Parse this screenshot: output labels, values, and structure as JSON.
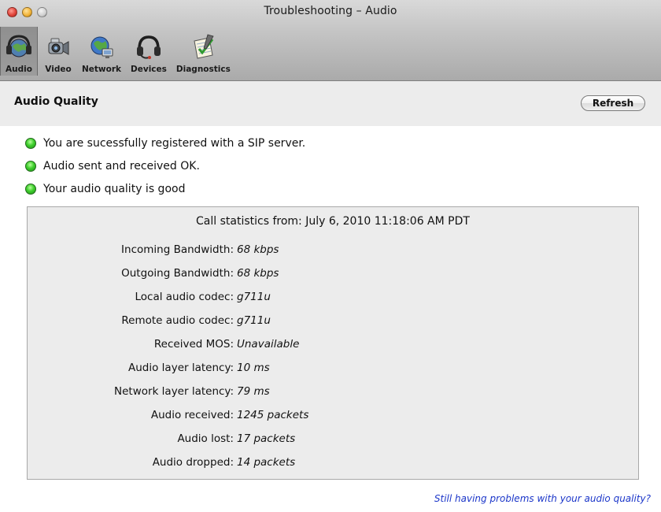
{
  "window": {
    "title": "Troubleshooting – Audio"
  },
  "toolbar": {
    "items": [
      {
        "label": "Audio",
        "icon": "headset-globe-icon",
        "selected": true
      },
      {
        "label": "Video",
        "icon": "video-camera-icon",
        "selected": false
      },
      {
        "label": "Network",
        "icon": "network-globe-icon",
        "selected": false
      },
      {
        "label": "Devices",
        "icon": "headset-icon",
        "selected": false
      },
      {
        "label": "Diagnostics",
        "icon": "diagnostics-notepad-icon",
        "selected": false
      }
    ]
  },
  "header": {
    "title": "Audio Quality",
    "refresh_label": "Refresh"
  },
  "status": [
    {
      "text": "You are sucessfully registered with a SIP server.",
      "state": "ok",
      "icon": "green-status-icon"
    },
    {
      "text": "Audio sent and received OK.",
      "state": "ok",
      "icon": "green-status-icon"
    },
    {
      "text": "Your audio quality is good",
      "state": "ok",
      "icon": "green-status-icon"
    }
  ],
  "stats": {
    "header": "Call statistics from: July 6, 2010 11:18:06 AM PDT",
    "rows": [
      {
        "label": "Incoming Bandwidth:",
        "value": "68 kbps"
      },
      {
        "label": "Outgoing Bandwidth:",
        "value": "68 kbps"
      },
      {
        "label": "Local audio codec:",
        "value": "g711u"
      },
      {
        "label": "Remote audio codec:",
        "value": "g711u"
      },
      {
        "label": "Received MOS:",
        "value": "Unavailable"
      },
      {
        "label": "Audio layer latency:",
        "value": "10 ms"
      },
      {
        "label": "Network layer latency:",
        "value": "79 ms"
      },
      {
        "label": "Audio received:",
        "value": "1245 packets"
      },
      {
        "label": "Audio lost:",
        "value": "17 packets"
      },
      {
        "label": "Audio dropped:",
        "value": "14 packets"
      }
    ]
  },
  "footer": {
    "help_link": "Still having problems with your audio quality?"
  },
  "colors": {
    "status_ok": "#3fcf2d",
    "link": "#1b36c9"
  }
}
